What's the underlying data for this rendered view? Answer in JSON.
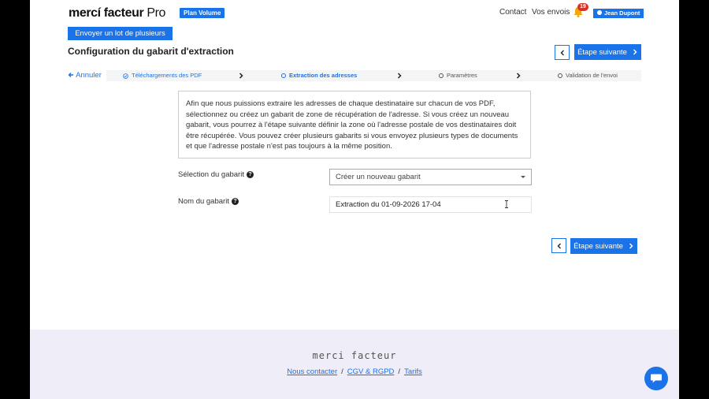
{
  "brand": {
    "name": "mercí facteur",
    "suffix": "Pro",
    "plan_badge": "Plan Volume"
  },
  "nav": {
    "contact": "Contact",
    "envois": "Vos envois",
    "notification_count": "19",
    "user_name": "Jean Dupont"
  },
  "actions": {
    "send_batch": "Envoyer un lot de plusieurs PDF"
  },
  "page": {
    "title": "Configuration du gabarit d'extraction"
  },
  "buttons": {
    "next_step": "Étape suivante"
  },
  "stepper": {
    "cancel": "Annuler",
    "steps": [
      {
        "label": "Téléchargements des PDF",
        "state": "done"
      },
      {
        "label": "Extraction des adresses",
        "state": "active"
      },
      {
        "label": "Paramètres",
        "state": "pending"
      },
      {
        "label": "Validation de l'envoi",
        "state": "pending"
      }
    ]
  },
  "info": {
    "text": "Afin que nous puissions extraire les adresses de chaque destinataire sur chacun de vos PDF, sélectionnez ou créez un gabarit de zone de récupération de l'adresse. Si vous créez un nouveau gabarit, vous pourrez à l'étape suivante définir la zone où l'adresse postale de vos destinataires doit être récupérée. Vous pouvez créer plusieurs gabarits si vous envoyez plusieurs types de documents et que l'adresse postale n'est pas toujours à la même position."
  },
  "form": {
    "template_select": {
      "label": "Sélection du gabarit",
      "value": "Créer un nouveau gabarit"
    },
    "template_name": {
      "label": "Nom du gabarit",
      "value": "Extraction du 01-09-2026 17-04"
    }
  },
  "footer": {
    "brand": "merci facteur",
    "links": [
      "Nous contacter",
      "CGV & RGPD",
      "Tarifs"
    ]
  },
  "colors": {
    "accent": "#1a73e8",
    "badge": "#d93025",
    "footer_bg": "#efedf8"
  }
}
